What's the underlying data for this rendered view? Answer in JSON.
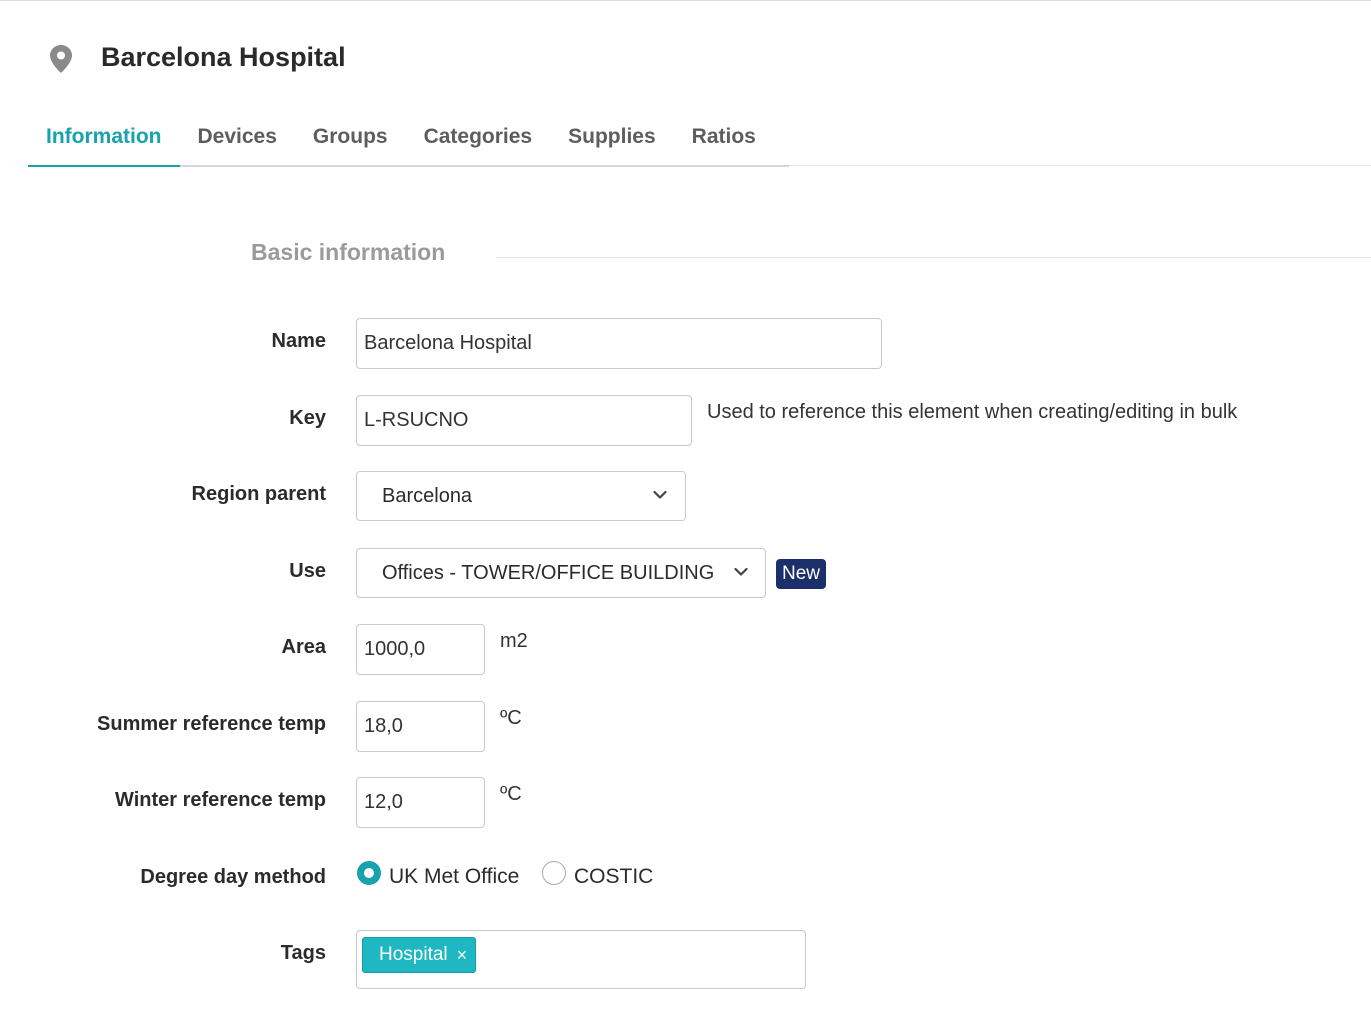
{
  "header": {
    "icon": "map-pin-icon",
    "title": "Barcelona Hospital"
  },
  "tabs": [
    {
      "label": "Information",
      "active": true
    },
    {
      "label": "Devices",
      "active": false
    },
    {
      "label": "Groups",
      "active": false
    },
    {
      "label": "Categories",
      "active": false
    },
    {
      "label": "Supplies",
      "active": false
    },
    {
      "label": "Ratios",
      "active": false
    }
  ],
  "section": {
    "title": "Basic information"
  },
  "form": {
    "name": {
      "label": "Name",
      "value": "Barcelona Hospital"
    },
    "key": {
      "label": "Key",
      "value": "L-RSUCNO",
      "hint": "Used to reference this element when creating/editing in bulk"
    },
    "region_parent": {
      "label": "Region parent",
      "value": "Barcelona"
    },
    "use": {
      "label": "Use",
      "value": "Offices - TOWER/OFFICE BUILDING",
      "badge": "New"
    },
    "area": {
      "label": "Area",
      "value": "1000,0",
      "unit": "m2"
    },
    "summer_temp": {
      "label": "Summer reference temp",
      "value": "18,0",
      "unit": "ºC"
    },
    "winter_temp": {
      "label": "Winter reference temp",
      "value": "12,0",
      "unit": "ºC"
    },
    "degree_day_method": {
      "label": "Degree day method",
      "options": [
        {
          "label": "UK Met Office",
          "selected": true
        },
        {
          "label": "COSTIC",
          "selected": false
        }
      ]
    },
    "tags": {
      "label": "Tags",
      "items": [
        "Hospital"
      ],
      "remove_glyph": "×"
    }
  },
  "colors": {
    "accent": "#17a2ad",
    "badge": "#1b2f6b",
    "tag": "#1fb7c1"
  }
}
